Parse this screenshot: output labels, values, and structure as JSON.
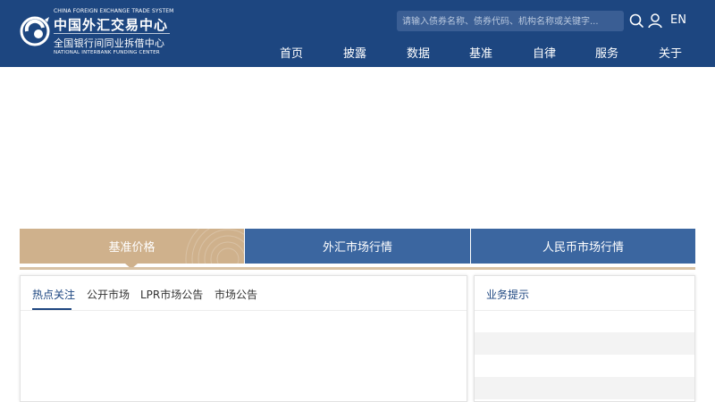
{
  "header": {
    "logo": {
      "en_top": "CHINA FOREIGN EXCHANGE TRADE SYSTEM",
      "cn_main": "中国外汇交易中心",
      "cn_sub": "全国银行间同业拆借中心",
      "en_sub": "NATIONAL INTERBANK FUNDING CENTER"
    },
    "search": {
      "placeholder": "请输入债券名称、债券代码、机构名称或关键字..."
    },
    "icons": [
      "search-icon",
      "user-icon"
    ],
    "lang": "EN",
    "nav": [
      "首页",
      "披露",
      "数据",
      "基准",
      "自律",
      "服务",
      "关于"
    ]
  },
  "market_tabs": [
    "基准价格",
    "外汇市场行情",
    "人民币市场行情"
  ],
  "left_panel": {
    "tabs": [
      "热点关注",
      "公开市场",
      "LPR市场公告",
      "市场公告"
    ]
  },
  "right_panel": {
    "title": "业务提示"
  },
  "colors": {
    "header_bg": "#1d4680",
    "tab_active": "#cfb18c",
    "tab_inactive": "#3b66a0",
    "accent": "#1d4680"
  }
}
